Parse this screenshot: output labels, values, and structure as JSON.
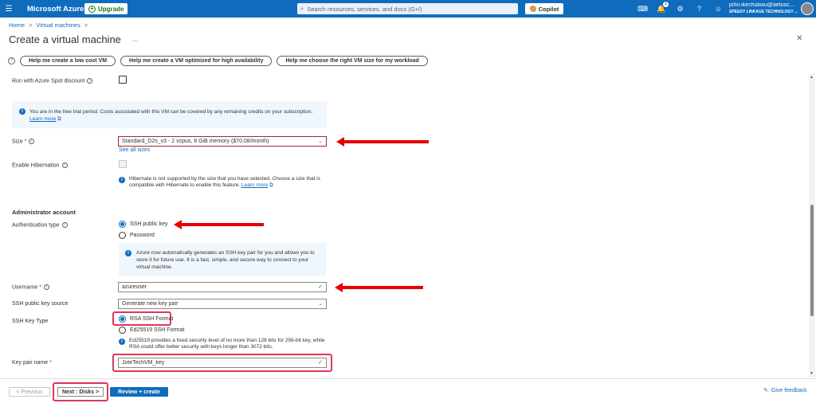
{
  "topbar": {
    "brand": "Microsoft Azure",
    "upgrade_label": "Upgrade",
    "search_placeholder": "Search resources, services, and docs (G+/)",
    "copilot_label": "Copilot",
    "notification_count": "1",
    "user_email": "john.ikechukwu@aetosc...",
    "user_org": "SPEEDY LINKAGE TECHNOLOGY ..."
  },
  "breadcrumb": [
    "Home",
    "Virtual machines"
  ],
  "page": {
    "title": "Create a virtual machine",
    "more": "...",
    "close": "✕"
  },
  "help_buttons": [
    "Help me create a low cost VM",
    "Help me create a VM optimized for high availability",
    "Help me choose the right VM size for my workload"
  ],
  "form": {
    "spot_label": "Run with Azure Spot discount",
    "free_trial_info": "You are in the free trial period. Costs associated with this VM can be covered by any remaining credits on your subscription.",
    "learn_more": "Learn more",
    "size_label": "Size",
    "size_value": "Standard_D2s_v3 - 2 vcpus, 8 GiB memory ($70.08/month)",
    "see_all_sizes": "See all sizes",
    "hibernation_label": "Enable Hibernation",
    "hibernation_note": "Hibernate is not supported by the size that you have selected. Choose a size that is compatible with Hibernate to enable this feature.",
    "hibernation_learn_more": "Learn more",
    "admin_section": "Administrator account",
    "auth_type_label": "Authentication type",
    "auth_options": [
      "SSH public key",
      "Password"
    ],
    "auth_info": "Azure now automatically generates an SSH key pair for you and allows you to store it for future use. It is a fast, simple, and secure way to connect to your virtual machine.",
    "username_label": "Username",
    "username_value": "azureuser",
    "key_source_label": "SSH public key source",
    "key_source_value": "Generate new key pair",
    "key_type_label": "SSH Key Type",
    "key_type_options": [
      "RSA SSH Format",
      "Ed25519 SSH Format"
    ],
    "key_type_note": "Ed25519 provides a fixed security level of no more than 128 bits for 256-bit key, while RSA could offer better security with keys longer than 3072 bits.",
    "key_pair_label": "Key pair name",
    "key_pair_value": "JoteTechVM_key"
  },
  "footer": {
    "previous": "< Previous",
    "next": "Next : Disks >",
    "review": "Review + create",
    "feedback": "Give feedback"
  },
  "colors": {
    "azure_blue": "#0f6cbd",
    "annotation_red": "#e60000",
    "highlight_pink": "#e3355a"
  }
}
